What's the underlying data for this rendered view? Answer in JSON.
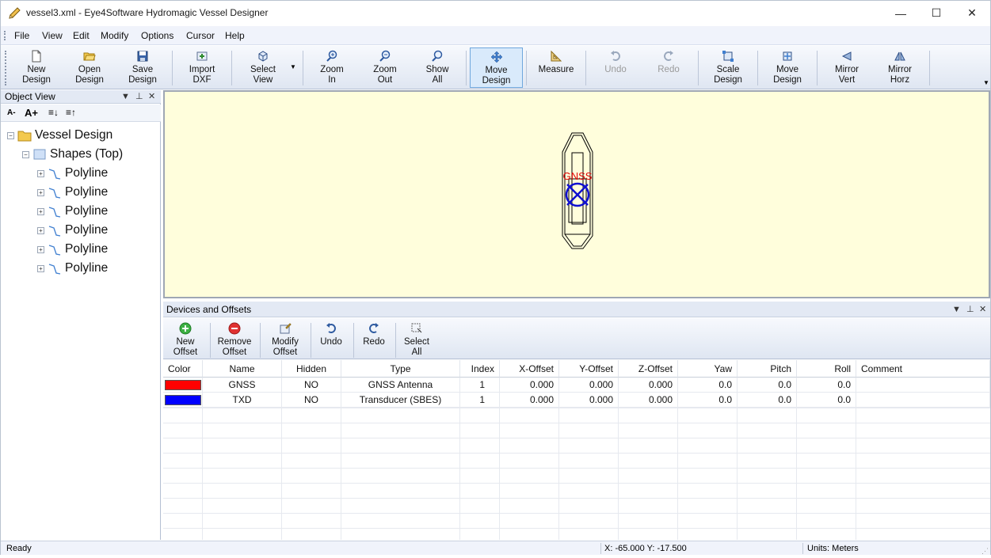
{
  "window": {
    "title": "vessel3.xml - Eye4Software Hydromagic Vessel Designer",
    "minimize": "—",
    "maximize": "☐",
    "close": "✕"
  },
  "menu": [
    "File",
    "View",
    "Edit",
    "Modify",
    "Options",
    "Cursor",
    "Help"
  ],
  "toolbar": {
    "new_design": [
      "New",
      "Design"
    ],
    "open_design": [
      "Open",
      "Design"
    ],
    "save_design": [
      "Save",
      "Design"
    ],
    "import_dxf": [
      "Import",
      "DXF"
    ],
    "select_view": [
      "Select",
      "View"
    ],
    "zoom_in": [
      "Zoom",
      "In"
    ],
    "zoom_out": [
      "Zoom",
      "Out"
    ],
    "show_all": [
      "Show",
      "All"
    ],
    "move_design": [
      "Move",
      "Design"
    ],
    "measure": [
      "Measure",
      ""
    ],
    "undo": [
      "Undo",
      ""
    ],
    "redo": [
      "Redo",
      ""
    ],
    "scale_design": [
      "Scale",
      "Design"
    ],
    "move_design2": [
      "Move",
      "Design"
    ],
    "mirror_vert": [
      "Mirror",
      "Vert"
    ],
    "mirror_horz": [
      "Mirror",
      "Horz"
    ]
  },
  "object_view": {
    "title": "Object View",
    "tools": [
      "A-",
      "A+"
    ],
    "root": "Vessel Design",
    "group": "Shapes (Top)",
    "items": [
      "Polyline",
      "Polyline",
      "Polyline",
      "Polyline",
      "Polyline",
      "Polyline"
    ]
  },
  "canvas": {
    "device_label": "GNSS",
    "colors": {
      "background": "#fffedc",
      "hull": "#000000",
      "gnss": "#e00000",
      "txd": "#1010d0"
    }
  },
  "devices_panel": {
    "title": "Devices and Offsets",
    "tools": {
      "new_offset": [
        "New",
        "Offset"
      ],
      "remove_offset": [
        "Remove",
        "Offset"
      ],
      "modify_offset": [
        "Modify",
        "Offset"
      ],
      "undo": [
        "Undo",
        ""
      ],
      "redo": [
        "Redo",
        ""
      ],
      "select_all": [
        "Select",
        "All"
      ]
    },
    "columns": [
      "Color",
      "Name",
      "Hidden",
      "Type",
      "Index",
      "X-Offset",
      "Y-Offset",
      "Z-Offset",
      "Yaw",
      "Pitch",
      "Roll",
      "Comment"
    ],
    "rows": [
      {
        "color": "#ff0000",
        "name": "GNSS",
        "hidden": "NO",
        "type": "GNSS Antenna",
        "index": "1",
        "x": "0.000",
        "y": "0.000",
        "z": "0.000",
        "yaw": "0.0",
        "pitch": "0.0",
        "roll": "0.0",
        "comment": ""
      },
      {
        "color": "#0000ff",
        "name": "TXD",
        "hidden": "NO",
        "type": "Transducer (SBES)",
        "index": "1",
        "x": "0.000",
        "y": "0.000",
        "z": "0.000",
        "yaw": "0.0",
        "pitch": "0.0",
        "roll": "0.0",
        "comment": ""
      }
    ]
  },
  "status": {
    "left": "Ready",
    "coords": "X: -65.000 Y: -17.500",
    "units": "Units: Meters"
  }
}
